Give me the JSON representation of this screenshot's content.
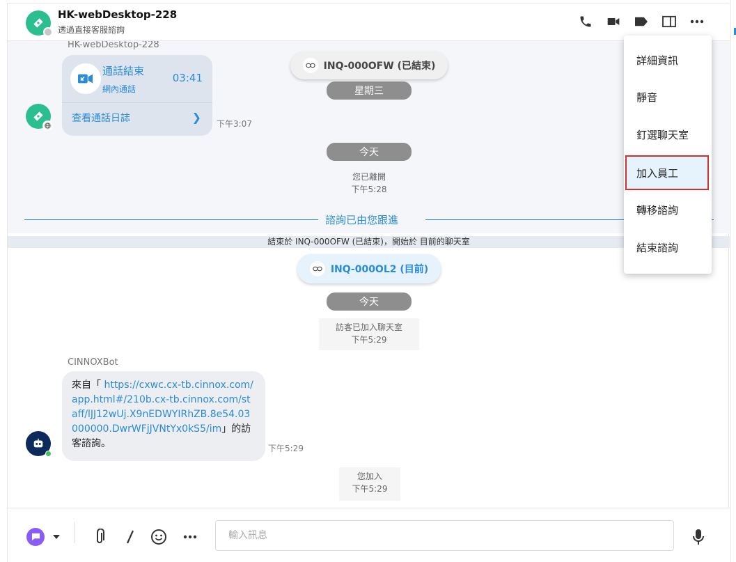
{
  "header": {
    "title": "HK-webDesktop-228",
    "subtitle": "透過直接客服諮詢",
    "icons": [
      "phone-icon",
      "video-icon",
      "tag-icon",
      "panel-icon",
      "more-icon"
    ]
  },
  "chat": {
    "prev_sender": "HK-webDesktop-228",
    "call_card": {
      "title": "通話結束",
      "subtitle": "網內通話",
      "duration": "03:41",
      "log_link": "查看通話日誌",
      "time": "下午3:07"
    },
    "inquiry_prev": "INQ-000OFW (已結束)",
    "day_wednesday": "星期三",
    "day_today": "今天",
    "left_note": {
      "text": "您已離開",
      "time": "下午5:28"
    },
    "follow_text": "諮詢已由您跟進",
    "transfer_banner": "結束於 INQ-000OFW (已結束)，開始於 目前的聊天室",
    "inquiry_current": "INQ-000OL2 (目前)",
    "day_today_2": "今天",
    "visitor_note": {
      "text": "訪客已加入聊天室",
      "time": "下午5:29"
    },
    "bot": {
      "name": "CINNOXBot",
      "prefix": "來自「 ",
      "link": "https://cxwc.cx-tb.cinnox.com/app.html#/210b.cx-tb.cinnox.com/staff/lJJ12wUj.X9nEDWYIRhZB.8e54.03000000.DwrWFjJVNtYx0kS5/im",
      "suffix": "」的訪客諮詢。",
      "time": "下午5:29"
    },
    "join_note": {
      "text": "您加入",
      "time": "下午5:29"
    }
  },
  "menu": {
    "items": [
      {
        "label": "詳細資訊"
      },
      {
        "label": "靜音"
      },
      {
        "label": "釘選聊天室"
      },
      {
        "label": "加入員工"
      },
      {
        "label": "轉移諮詢"
      },
      {
        "label": "結束諮詢"
      }
    ],
    "highlighted": "加入員工"
  },
  "composer": {
    "placeholder": "輸入訊息",
    "value": ""
  },
  "colors": {
    "accent": "#2a8bd8",
    "brand_green": "#2bbf8f",
    "bot_navy": "#0d2a5c",
    "highlight_border": "#d32f2f",
    "composer_purple": "#8a5cf6"
  }
}
